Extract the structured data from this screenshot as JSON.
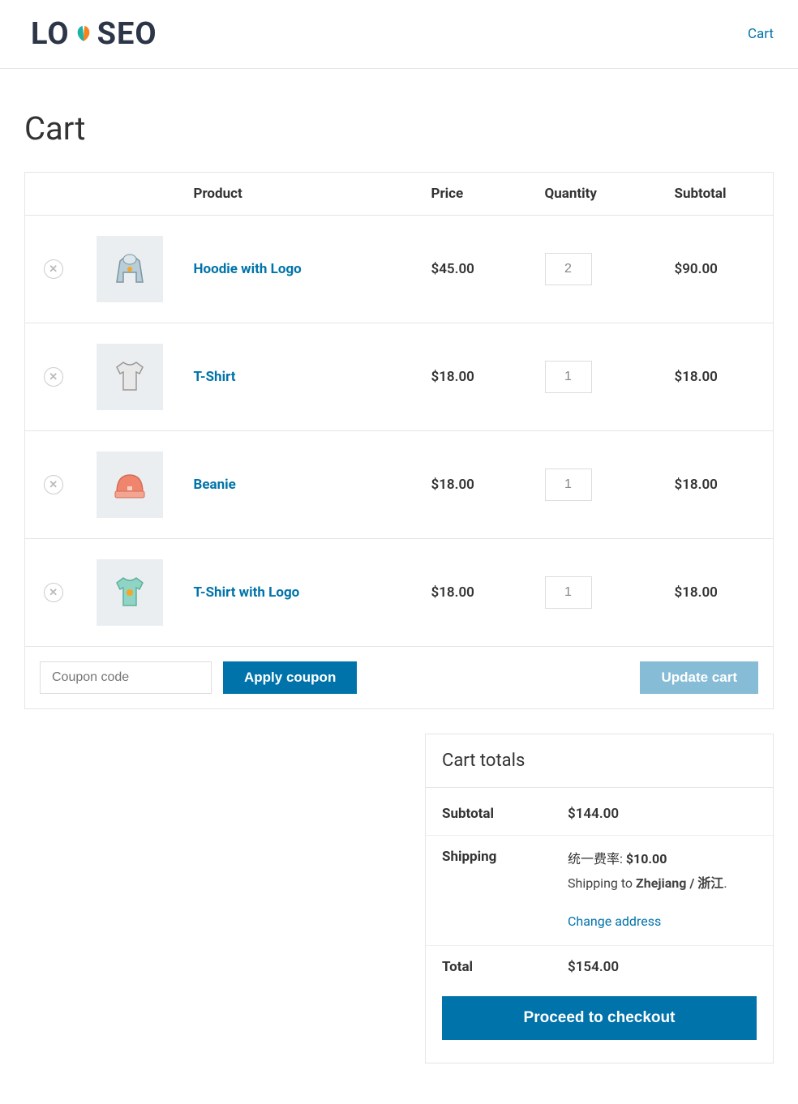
{
  "header": {
    "logo_pre": "LO",
    "logo_post": "SEO",
    "nav_cart": "Cart"
  },
  "page": {
    "title": "Cart"
  },
  "table": {
    "headers": {
      "product": "Product",
      "price": "Price",
      "quantity": "Quantity",
      "subtotal": "Subtotal"
    },
    "items": [
      {
        "name": "Hoodie with Logo",
        "price": "$45.00",
        "qty": "2",
        "subtotal": "$90.00",
        "icon": "hoodie"
      },
      {
        "name": "T-Shirt",
        "price": "$18.00",
        "qty": "1",
        "subtotal": "$18.00",
        "icon": "tshirt"
      },
      {
        "name": "Beanie",
        "price": "$18.00",
        "qty": "1",
        "subtotal": "$18.00",
        "icon": "beanie"
      },
      {
        "name": "T-Shirt with Logo",
        "price": "$18.00",
        "qty": "1",
        "subtotal": "$18.00",
        "icon": "tshirt-logo"
      }
    ],
    "coupon_placeholder": "Coupon code",
    "apply_coupon": "Apply coupon",
    "update_cart": "Update cart"
  },
  "totals": {
    "heading": "Cart totals",
    "subtotal_label": "Subtotal",
    "subtotal_value": "$144.00",
    "shipping_label": "Shipping",
    "shipping_rate_label": "统一费率: ",
    "shipping_rate_price": "$10.00",
    "shipping_to_prefix": "Shipping to ",
    "shipping_region": "Zhejiang / 浙江",
    "shipping_suffix": ".",
    "change_address": "Change address",
    "total_label": "Total",
    "total_value": "$154.00",
    "checkout": "Proceed to checkout"
  }
}
